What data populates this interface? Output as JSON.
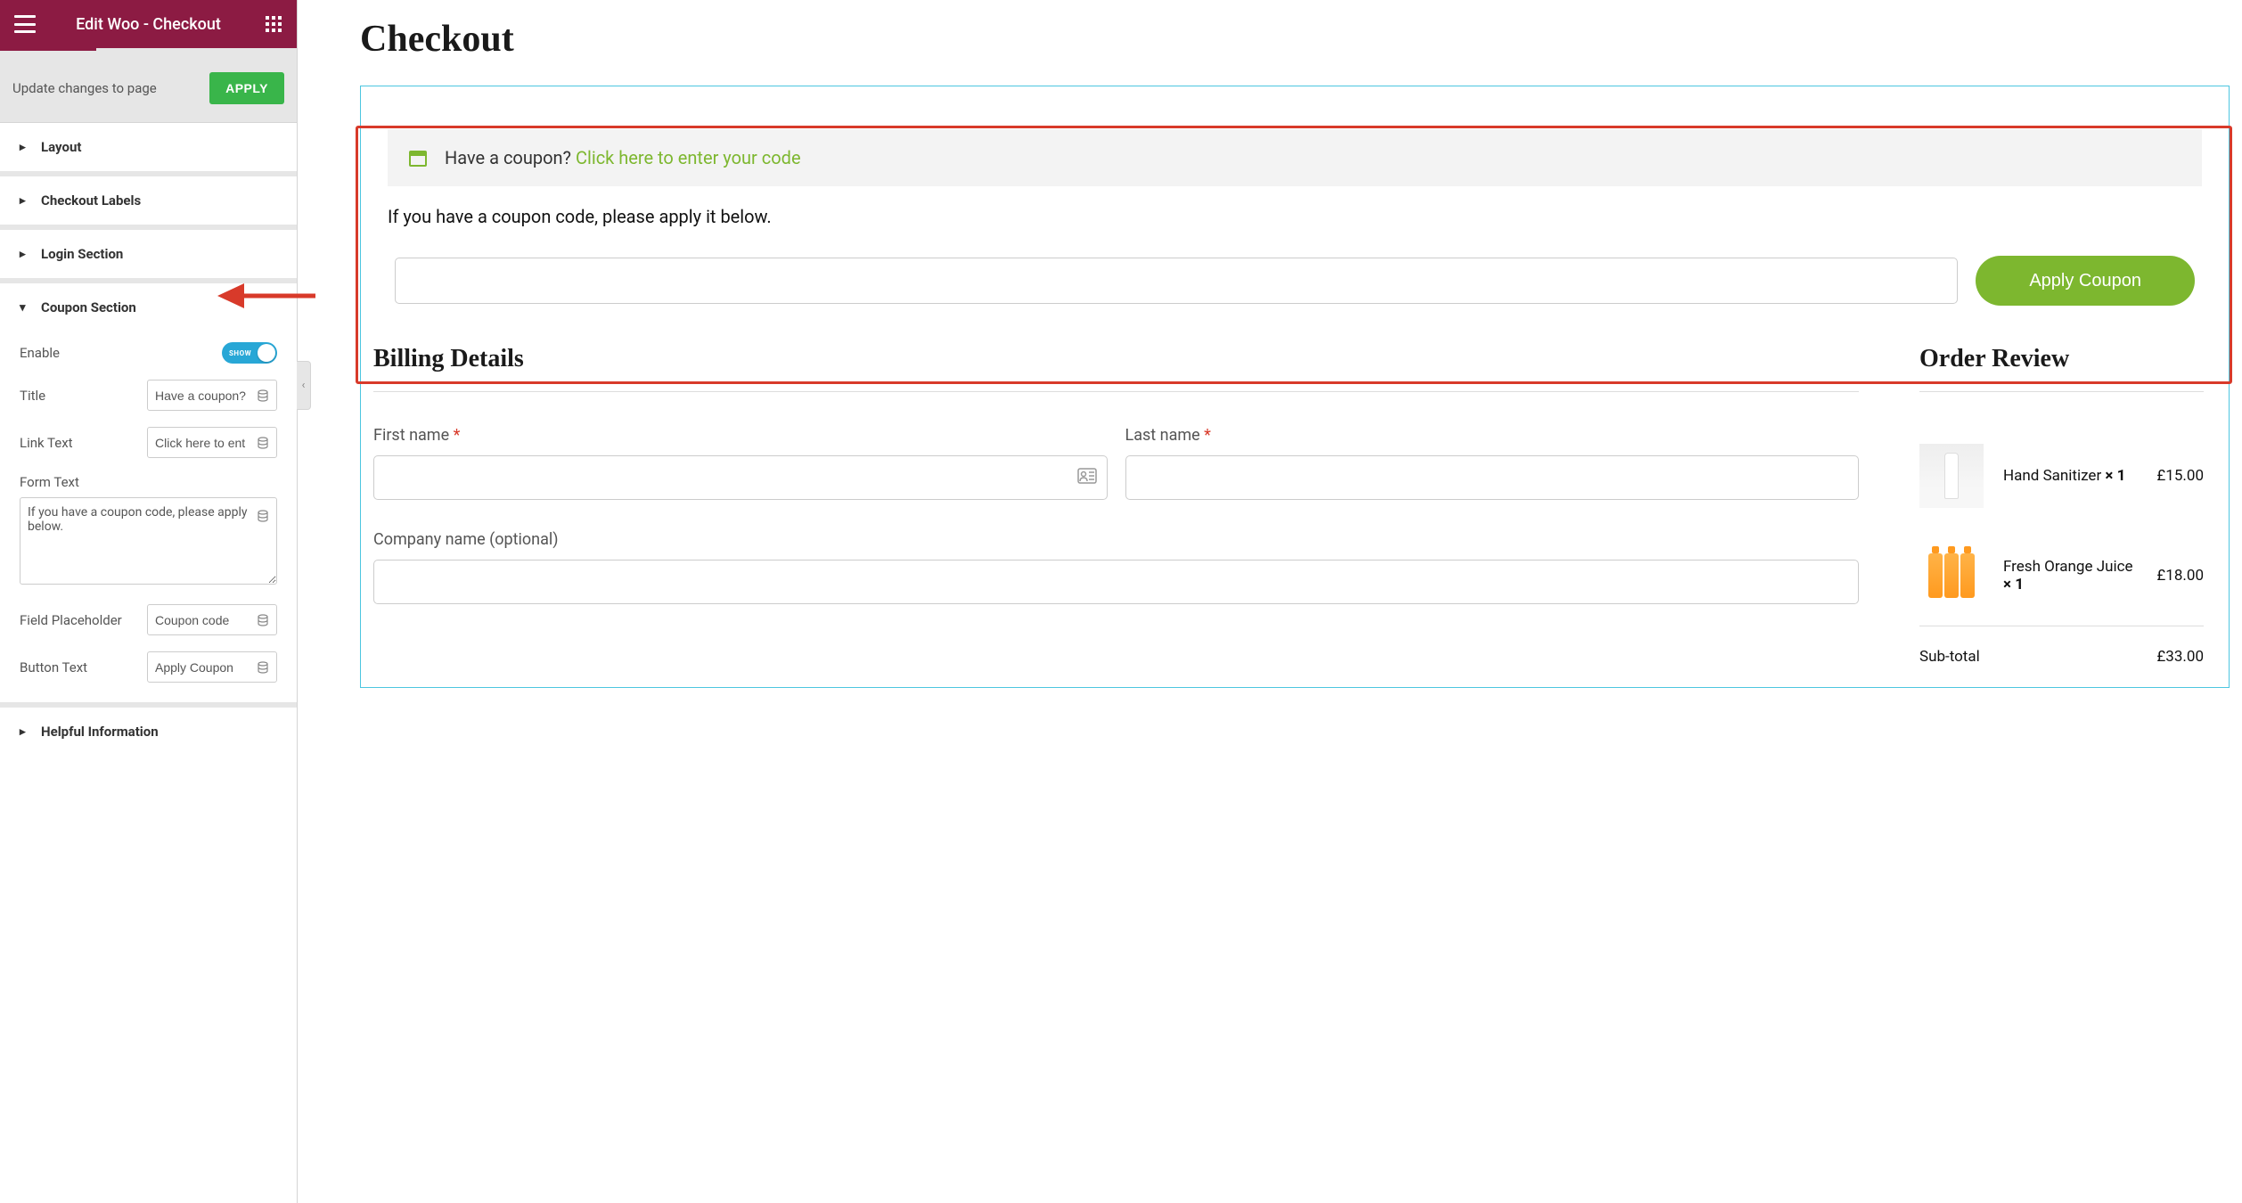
{
  "sidebar": {
    "title": "Edit Woo - Checkout",
    "update_text": "Update changes to page",
    "apply_label": "APPLY",
    "sections": {
      "layout": "Layout",
      "checkout_labels": "Checkout Labels",
      "login_section": "Login Section",
      "coupon_section": "Coupon Section",
      "helpful_info": "Helpful Information"
    },
    "coupon": {
      "enable_label": "Enable",
      "toggle_text": "SHOW",
      "title_label": "Title",
      "title_value": "Have a coupon?",
      "link_label": "Link Text",
      "link_value": "Click here to ent",
      "form_label": "Form Text",
      "form_value": "If you have a coupon code, please apply below.",
      "placeholder_label": "Field Placeholder",
      "placeholder_value": "Coupon code",
      "button_label": "Button Text",
      "button_value": "Apply Coupon"
    }
  },
  "preview": {
    "page_title": "Checkout",
    "coupon_banner_prompt": "Have a coupon? ",
    "coupon_banner_link": "Click here to enter your code",
    "coupon_instruction": "If you have a coupon code, please apply it below.",
    "coupon_button": "Apply Coupon",
    "billing": {
      "title": "Billing Details",
      "first_name": "First name ",
      "last_name": "Last name ",
      "company": "Company name (optional)"
    },
    "order": {
      "title": "Order Review",
      "items": [
        {
          "name": "Hand Sanitizer  ",
          "qty": "× 1",
          "price": "£15.00"
        },
        {
          "name": "Fresh Orange Juice  ",
          "qty": "× 1",
          "price": "£18.00"
        }
      ],
      "subtotal_label": "Sub-total",
      "subtotal_value": "£33.00"
    }
  }
}
